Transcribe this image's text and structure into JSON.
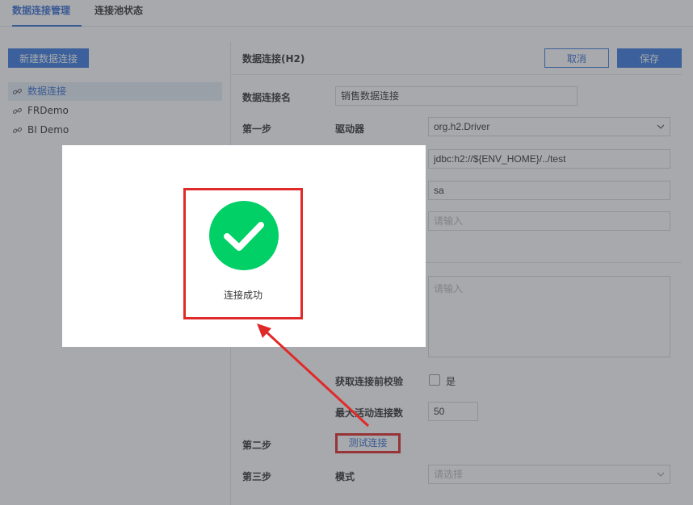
{
  "tabs": [
    {
      "label": "数据连接管理",
      "active": true
    },
    {
      "label": "连接池状态",
      "active": false
    }
  ],
  "sidebar": {
    "new_button": "新建数据连接",
    "connections": [
      {
        "label": "数据连接",
        "icon": "link-icon",
        "selected": true
      },
      {
        "label": "FRDemo",
        "icon": "link-icon",
        "selected": false
      },
      {
        "label": "BI Demo",
        "icon": "link-icon",
        "selected": false
      }
    ]
  },
  "form": {
    "title": "数据连接(H2)",
    "cancel_label": "取消",
    "save_label": "保存",
    "conn_name_label": "数据连接名",
    "conn_name_value": "销售数据连接",
    "step1_label": "第一步",
    "driver_label": "驱动器",
    "driver_value": "org.h2.Driver",
    "url_value": "jdbc:h2://${ENV_HOME}/../test",
    "user_value": "sa",
    "password_placeholder": "请输入",
    "sql_placeholder": "请输入",
    "validate_label": "获取连接前校验",
    "validate_checkbox_label": "是",
    "validate_checked": false,
    "max_active_label": "最大活动连接数",
    "max_active_value": "50",
    "step2_label": "第二步",
    "test_button": "测试连接",
    "step3_label": "第三步",
    "mode_label": "模式",
    "mode_placeholder": "请选择"
  },
  "modal": {
    "message": "连接成功",
    "icon": "check-circle-icon"
  },
  "colors": {
    "accent": "#3b7be0",
    "success": "#00d065",
    "annotation": "#e02a2a",
    "overlay": "rgba(60,64,70,0.45)"
  }
}
